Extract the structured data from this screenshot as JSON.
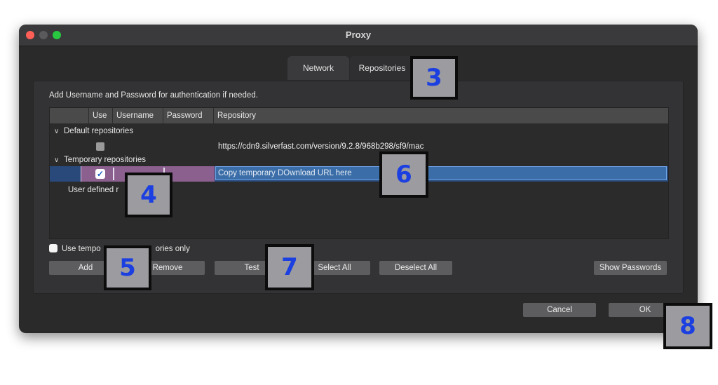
{
  "window": {
    "title": "Proxy"
  },
  "tabs": [
    {
      "label": "Network"
    },
    {
      "label": "Repositories"
    }
  ],
  "panel": {
    "instruction": "Add Username and Password for authentication if needed.",
    "columns": [
      "Use",
      "Username",
      "Password",
      "Repository"
    ],
    "groups": {
      "default": "Default repositories",
      "temporary": "Temporary repositories",
      "user_defined": "User defined r"
    },
    "default_repo_url": "https://cdn9.silverfast.com/version/9.2.8/968b298/sf9/mac",
    "temporary_repo_placeholder": "Copy temporary DOwnload URL here",
    "use_temporary_label": "Use tempo",
    "use_temporary_label_tail": "ories only"
  },
  "buttons": {
    "add": "Add",
    "remove": "Remove",
    "test": "Test",
    "select_all": "Select All",
    "deselect_all": "Deselect All",
    "show_passwords": "Show Passwords",
    "cancel": "Cancel",
    "ok": "OK"
  },
  "callouts": [
    "3",
    "4",
    "5",
    "6",
    "7",
    "8"
  ],
  "icons": {
    "chevron": "chevron-down-icon",
    "check": "checkmark-icon"
  },
  "colors": {
    "window_bg": "#2a2a2b",
    "selection_row": "#28497a",
    "selection_cell": "#8b5f8e",
    "input_highlight": "#3b6ea8",
    "callout_text": "#1b3fe0",
    "callout_bg": "#9b9ba0"
  }
}
